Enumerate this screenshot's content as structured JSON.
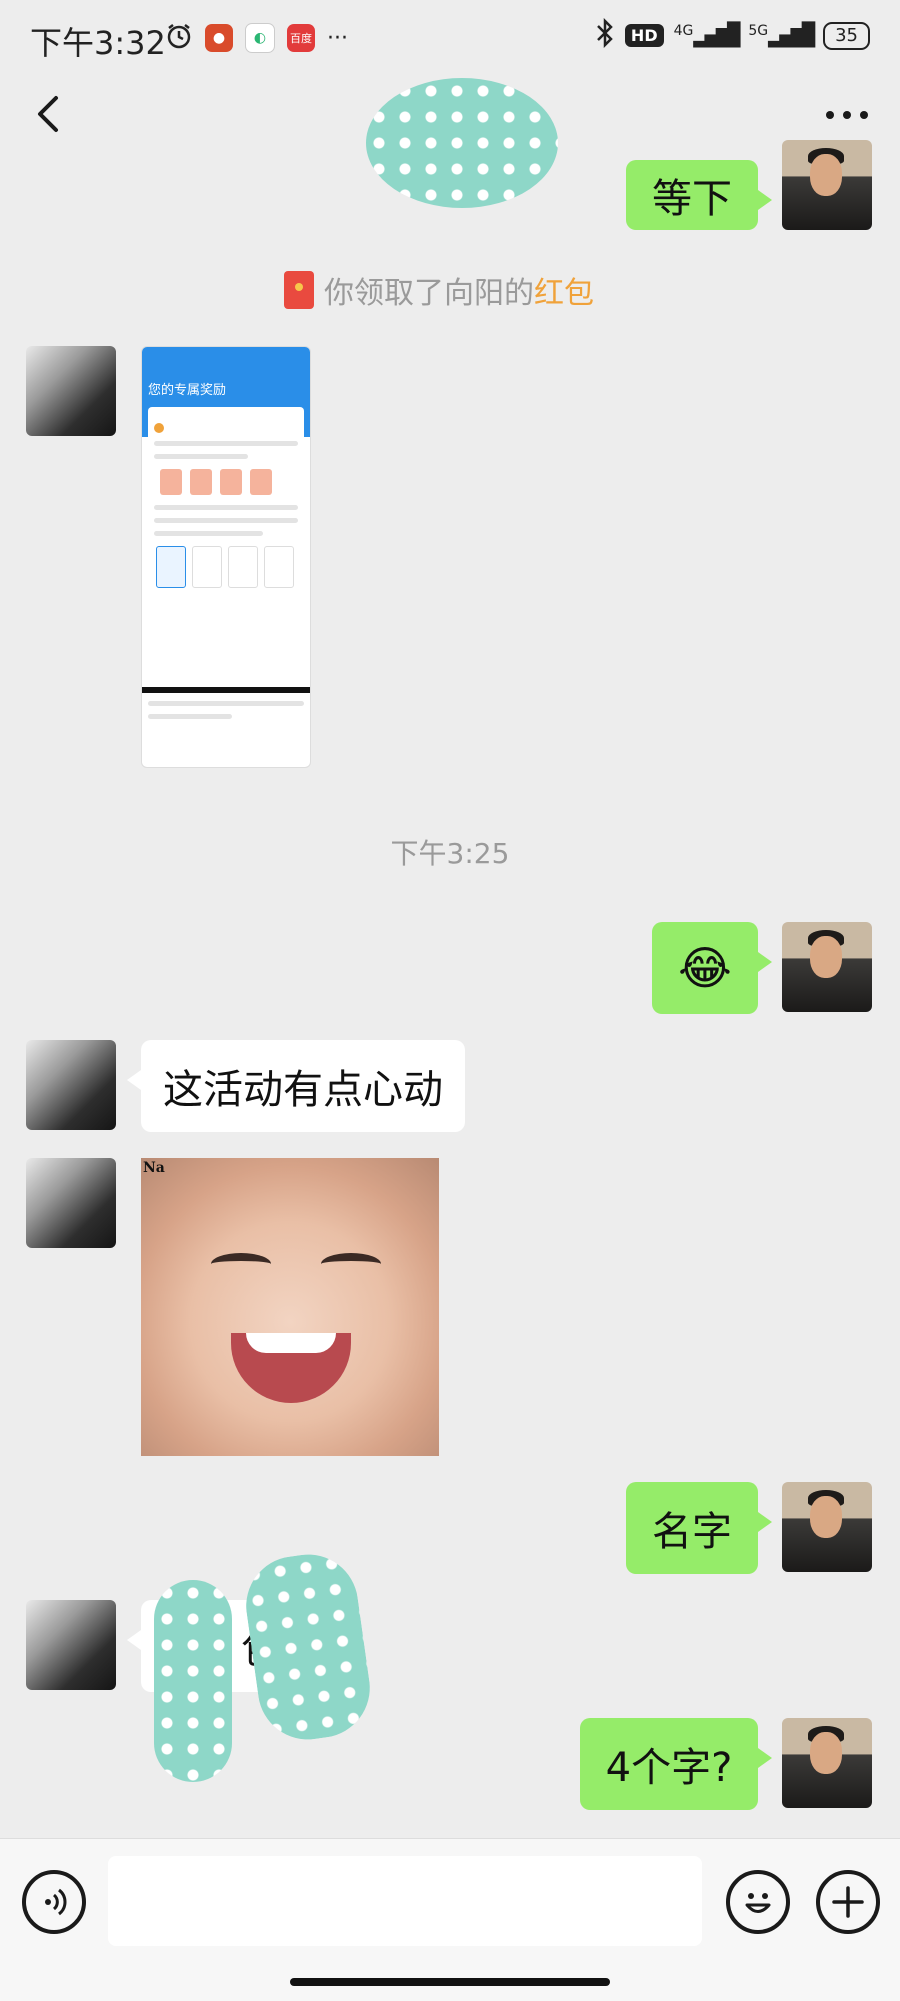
{
  "status_bar": {
    "time": "下午3:32",
    "app_badge_text": "百度",
    "more": "···",
    "hd": "HD",
    "net1": "4G",
    "net2": "5G",
    "battery": "35"
  },
  "header": {
    "back_icon": "chevron-left-icon",
    "more": "···"
  },
  "messages": {
    "m1": "等下",
    "system_prefix": "你领取了向阳的",
    "system_highlight": "红包",
    "shot_title": "您的专属奖励",
    "timestamp": "下午3:25",
    "m3_emoji": "😂",
    "m4": "这活动有点心动",
    "photo_tag": "Na",
    "m6": "名字",
    "m7_partial": "包",
    "m8": "4个字?"
  },
  "input_bar": {
    "placeholder": ""
  }
}
